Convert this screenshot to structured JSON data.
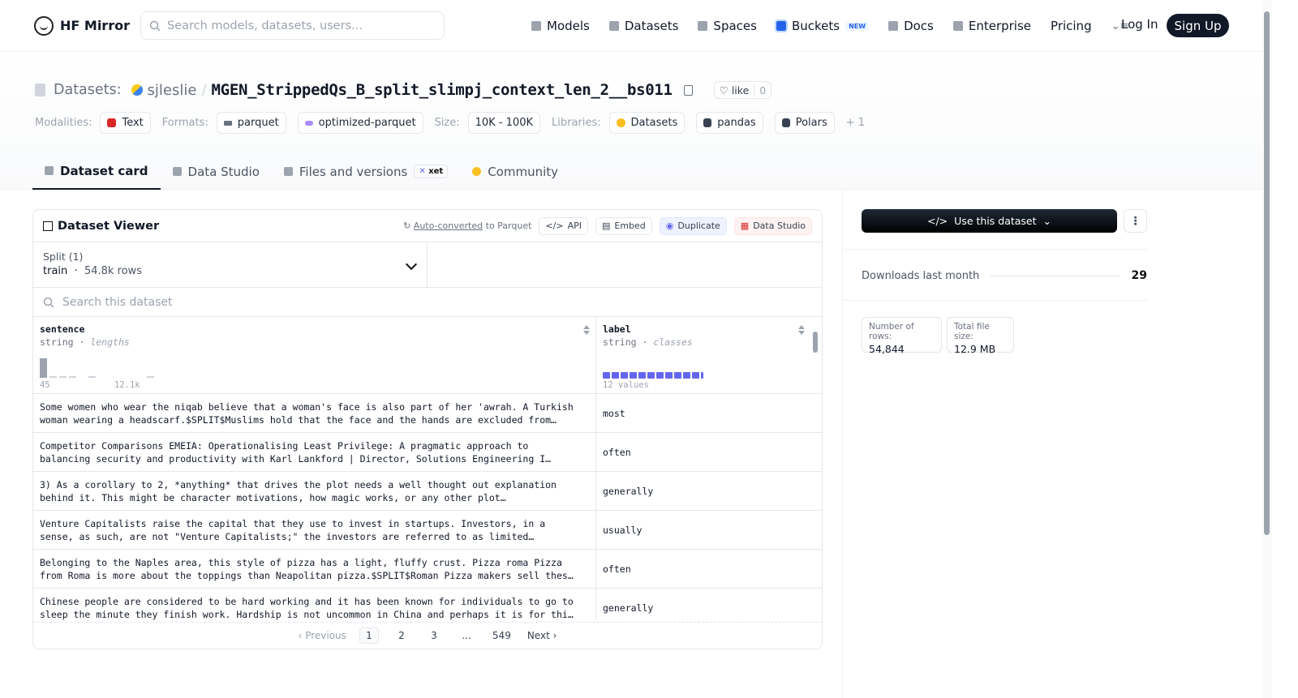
{
  "nav": {
    "brand": "HF Mirror",
    "search_placeholder": "Search models, datasets, users...",
    "links": [
      "Models",
      "Datasets",
      "Spaces",
      "Buckets",
      "Docs",
      "Enterprise",
      "Pricing"
    ],
    "buckets_badge": "NEW",
    "login": "Log In",
    "signup": "Sign Up"
  },
  "header": {
    "label": "Datasets:",
    "owner": "sjleslie",
    "slash": "/",
    "name": "MGEN_StrippedQs_B_split_slimpj_context_len_2__bs011",
    "like_label": "like",
    "like_count": "0",
    "modalities_label": "Modalities:",
    "modalities": [
      "Text"
    ],
    "formats_label": "Formats:",
    "formats": [
      "parquet",
      "optimized-parquet"
    ],
    "size_label": "Size:",
    "size": "10K - 100K",
    "libraries_label": "Libraries:",
    "libraries": [
      "Datasets",
      "pandas",
      "Polars"
    ],
    "libraries_more": "+ 1"
  },
  "tabs": [
    "Dataset card",
    "Data Studio",
    "Files and versions",
    "Community"
  ],
  "xet_badge": "xet",
  "viewer": {
    "title": "Dataset Viewer",
    "auto_converted": "Auto-converted",
    "to_parquet": "to Parquet",
    "btn_api": "API",
    "btn_embed": "Embed",
    "btn_duplicate": "Duplicate",
    "btn_studio": "Data Studio",
    "split_caption": "Split (1)",
    "split_name": "train",
    "split_rows": "54.8k rows",
    "search_placeholder": "Search this dataset",
    "col1_name": "sentence",
    "col1_type": "string",
    "col1_sub": "lengths",
    "col1_min": "45",
    "col1_max": "12.1k",
    "col2_name": "label",
    "col2_type": "string",
    "col2_sub": "classes",
    "col2_count": "12 values",
    "rows": [
      {
        "l1": "Some women who wear the niqab believe that a woman's face is also part of her 'awrah. A Turkish",
        "l2": "woman wearing a headscarf.$SPLIT$Muslims hold that the face and the hands are excluded from…",
        "label": "most"
      },
      {
        "l1": "Competitor Comparisons EMEIA: Operationalising Least Privilege: A pragmatic approach to",
        "l2": "balancing security and productivity with Karl Lankford | Director, Solutions Engineering I…",
        "label": "often"
      },
      {
        "l1": "3) As a corollary to 2, *anything* that drives the plot needs a well thought out explanation",
        "l2": "behind it. This might be character motivations, how magic works, or any other plot…",
        "label": "generally"
      },
      {
        "l1": "Venture Capitalists raise the capital that they use to invest in startups. Investors, in a",
        "l2": "sense, as such, are not \"Venture Capitalists;\" the investors are referred to as limited…",
        "label": "usually"
      },
      {
        "l1": "Belonging to the Naples area, this style of pizza has a light, fluffy crust. Pizza roma Pizza",
        "l2": "from Roma is more about the toppings than Neapolitan pizza.$SPLIT$Roman Pizza makers sell thes…",
        "label": "often"
      },
      {
        "l1": "Chinese people are considered to be hard working and it has been known for individuals to go to",
        "l2": "sleep the minute they finish work. Hardship is not uncommon in China and perhaps it is for thi…",
        "label": "generally"
      }
    ],
    "pager": {
      "prev": "Previous",
      "pages": [
        "1",
        "2",
        "3",
        "...",
        "549"
      ],
      "next": "Next"
    }
  },
  "side": {
    "use_btn": "Use this dataset",
    "downloads_label": "Downloads last month",
    "downloads": "29",
    "rows_label": "Number of rows:",
    "rows_value": "54,844",
    "size_label": "Total file size:",
    "size_value": "12.9 MB"
  }
}
